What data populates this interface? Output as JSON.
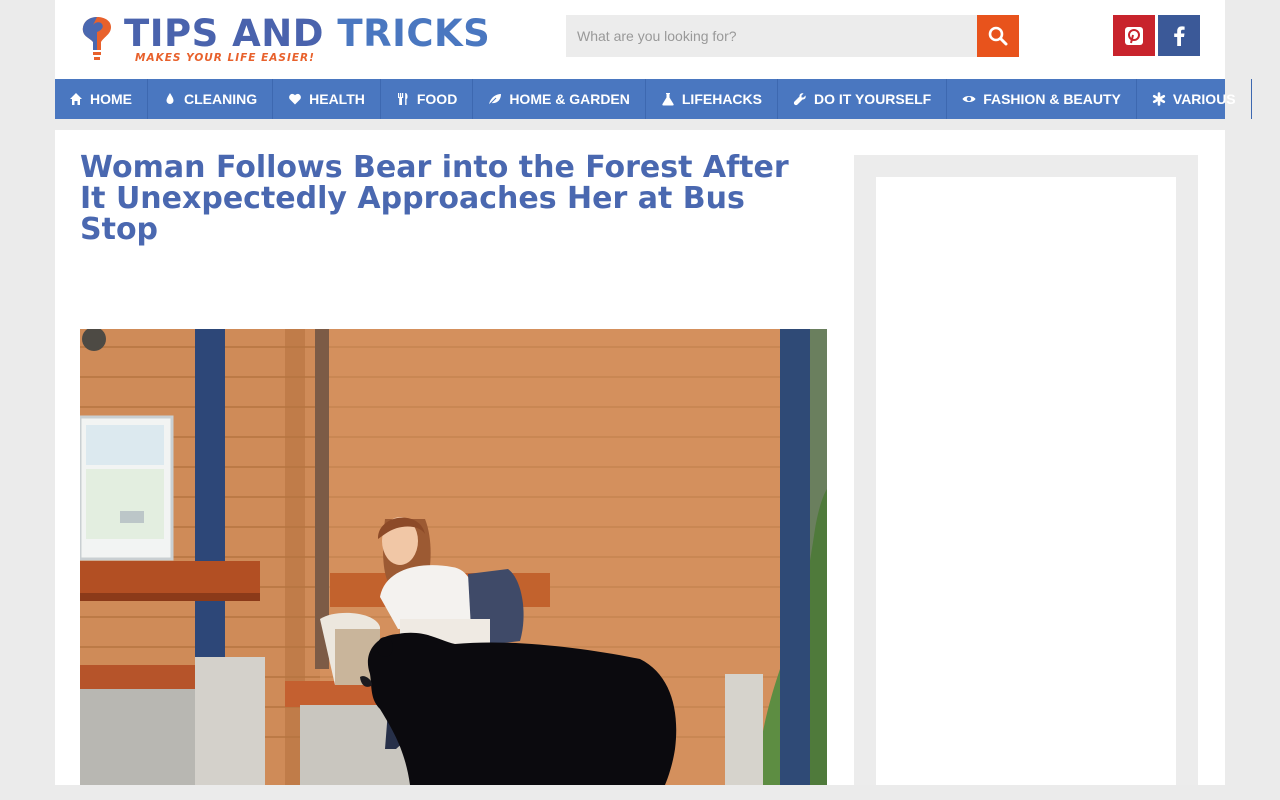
{
  "header": {
    "logo": {
      "title_part1": "TIPS AND ",
      "title_part2": "TRICKS",
      "tagline": "MAKES YOUR LIFE EASIER!"
    },
    "search": {
      "placeholder": "What are you looking for?",
      "button_icon": "search-icon"
    },
    "social": [
      {
        "name": "pinterest",
        "icon": "pinterest-icon",
        "color": "#c8232c"
      },
      {
        "name": "facebook",
        "icon": "facebook-icon",
        "color": "#3b5998"
      }
    ]
  },
  "nav": {
    "items": [
      {
        "label": "HOME",
        "icon": "home-icon"
      },
      {
        "label": "CLEANING",
        "icon": "droplet-icon"
      },
      {
        "label": "HEALTH",
        "icon": "heart-icon"
      },
      {
        "label": "FOOD",
        "icon": "cutlery-icon"
      },
      {
        "label": "HOME & GARDEN",
        "icon": "leaf-icon"
      },
      {
        "label": "LIFEHACKS",
        "icon": "flask-icon"
      },
      {
        "label": "DO IT YOURSELF",
        "icon": "wrench-icon"
      },
      {
        "label": "FASHION & BEAUTY",
        "icon": "eye-icon"
      },
      {
        "label": "VARIOUS",
        "icon": "asterisk-icon"
      }
    ],
    "color": "#4a77c0"
  },
  "article": {
    "title": "Woman Follows Bear into the Forest After It Unexpectedly Approaches Her at Bus Stop",
    "image_icon": "bear-at-bus-stop-photo"
  },
  "colors": {
    "brand_blue": "#4a68b0",
    "accent_orange": "#e8531c",
    "page_bg": "#ebebeb"
  }
}
